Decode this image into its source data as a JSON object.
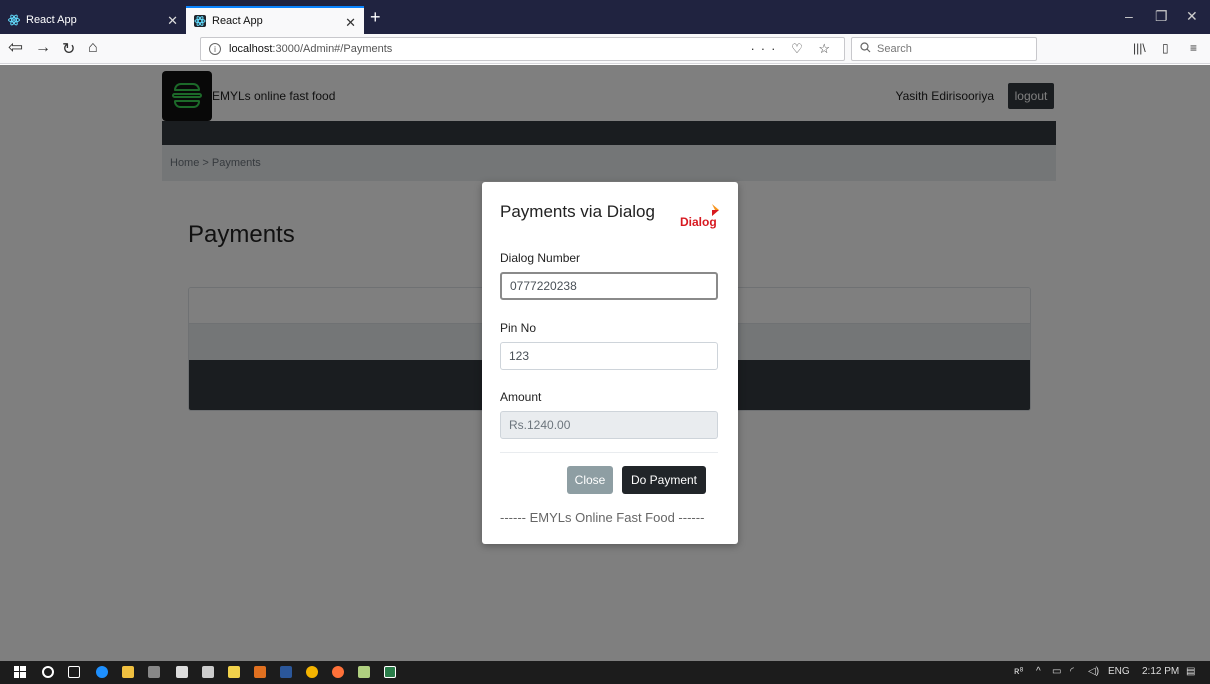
{
  "browser": {
    "tabs": [
      {
        "title": "React App",
        "active": false
      },
      {
        "title": "React App",
        "active": true
      }
    ],
    "url_host": "localhost",
    "url_path": ":3000/Admin#/Payments",
    "search_placeholder": "Search",
    "url_actions": "··· ♡ ☆",
    "new_tab": "+"
  },
  "header": {
    "brand": "EMYLs online fast food",
    "user": "Yasith Edirisooriya",
    "logout": "logout"
  },
  "breadcrumb": "Home > Payments",
  "page_title": "Payments",
  "modal": {
    "title": "Payments via Dialog",
    "logo_text": "Dialog",
    "fields": [
      {
        "label": "Dialog Number",
        "value": "0777220238"
      },
      {
        "label": "Pin No",
        "value": "123"
      },
      {
        "label": "Amount",
        "value": "Rs.1240.00"
      }
    ],
    "close_label": "Close",
    "pay_label": "Do Payment",
    "footer": "------ EMYLs Online Fast Food ------"
  },
  "taskbar": {
    "lang": "ENG",
    "time": "2:12 PM"
  },
  "colors": {
    "accent_dark": "#343a40",
    "dialog_red": "#d71920",
    "burger_green": "#39d353"
  }
}
